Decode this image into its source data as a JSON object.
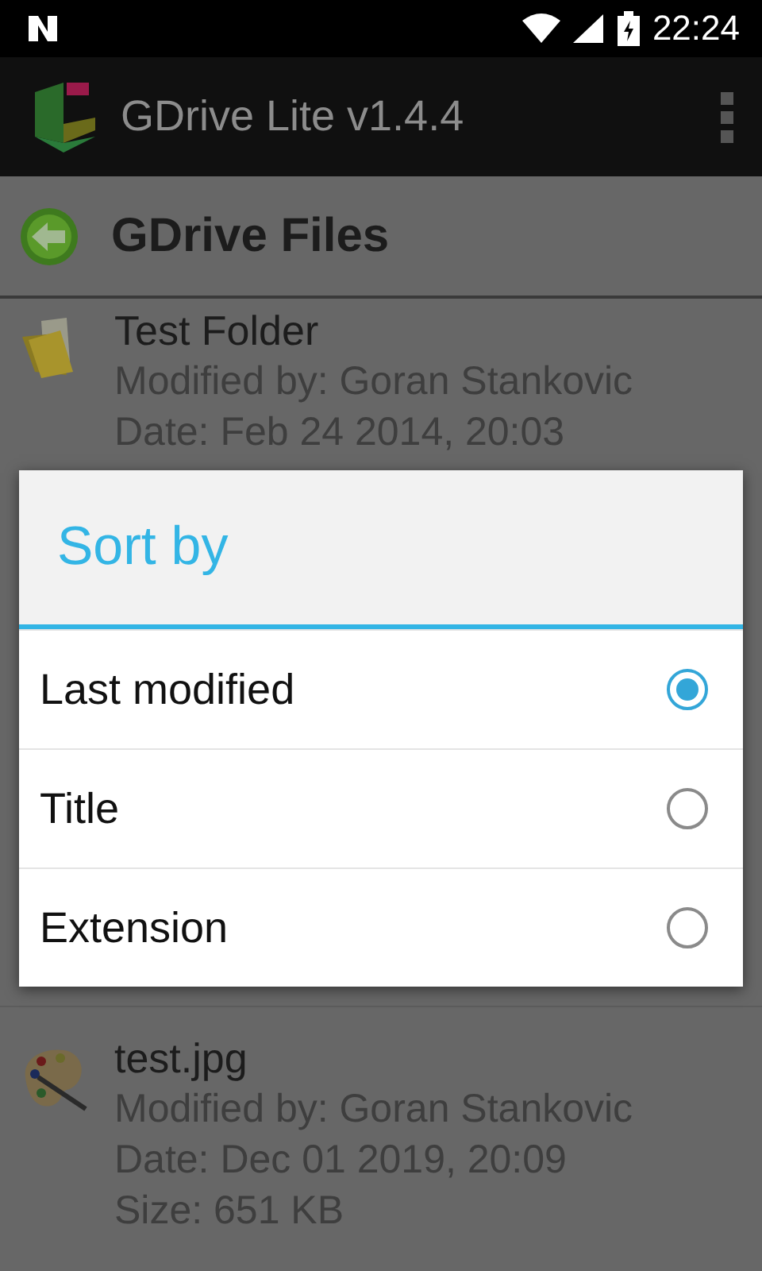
{
  "status_bar": {
    "time": "22:24"
  },
  "app_bar": {
    "title": "GDrive Lite v1.4.4"
  },
  "header": {
    "title": "GDrive Files"
  },
  "files": [
    {
      "kind": "folder",
      "name": "Test Folder",
      "lines": [
        "Modified by: Goran Stankovic",
        "Date: Feb 24 2014, 20:03"
      ]
    },
    {
      "kind": "image",
      "name": "test.jpg",
      "lines": [
        "Modified by: Goran Stankovic",
        "Date: Dec 01 2019, 20:09",
        "Size: 651 KB"
      ]
    }
  ],
  "dialog": {
    "title": "Sort by",
    "options": [
      {
        "label": "Last modified",
        "selected": true
      },
      {
        "label": "Title",
        "selected": false
      },
      {
        "label": "Extension",
        "selected": false
      }
    ]
  }
}
